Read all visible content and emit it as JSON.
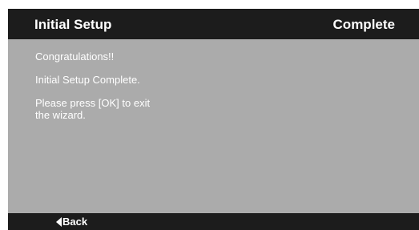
{
  "header": {
    "title": "Initial Setup",
    "status": "Complete"
  },
  "content": {
    "lines": [
      "Congratulations!!",
      "Initial Setup Complete.",
      "Please press [OK] to exit\nthe wizard."
    ]
  },
  "footer": {
    "back_label": "Back",
    "back_icon": "left-triangle-icon"
  },
  "colors": {
    "header_bg": "#1c1c1c",
    "panel_bg": "#ababab",
    "text": "#ffffff"
  }
}
